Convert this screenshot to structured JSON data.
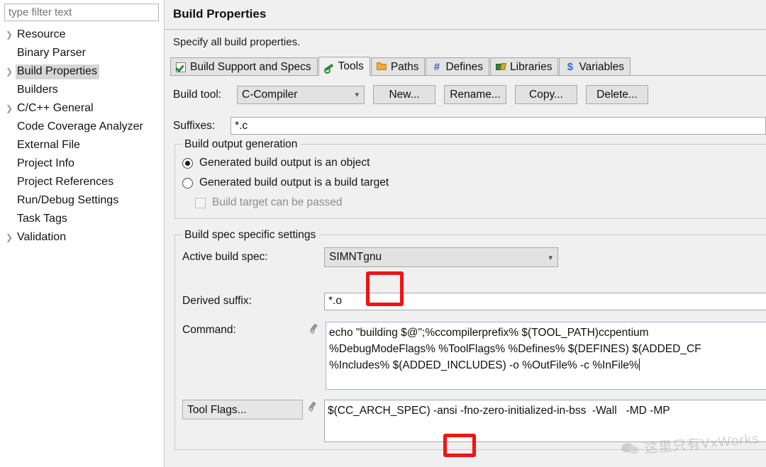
{
  "sidebar": {
    "filter_placeholder": "type filter text",
    "items": [
      {
        "label": "Resource",
        "expandable": true,
        "selected": false
      },
      {
        "label": "Binary Parser",
        "expandable": false,
        "selected": false
      },
      {
        "label": "Build Properties",
        "expandable": true,
        "selected": true
      },
      {
        "label": "Builders",
        "expandable": false,
        "selected": false
      },
      {
        "label": "C/C++ General",
        "expandable": true,
        "selected": false
      },
      {
        "label": "Code Coverage Analyzer",
        "expandable": false,
        "selected": false
      },
      {
        "label": "External File",
        "expandable": false,
        "selected": false
      },
      {
        "label": "Project Info",
        "expandable": false,
        "selected": false
      },
      {
        "label": "Project References",
        "expandable": false,
        "selected": false
      },
      {
        "label": "Run/Debug Settings",
        "expandable": false,
        "selected": false
      },
      {
        "label": "Task Tags",
        "expandable": false,
        "selected": false
      },
      {
        "label": "Validation",
        "expandable": true,
        "selected": false
      }
    ]
  },
  "page": {
    "title": "Build Properties",
    "description": "Specify all build properties."
  },
  "tabs": [
    {
      "label": "Build Support and Specs",
      "icon": "checkbox-checked-icon",
      "active": false
    },
    {
      "label": "Tools",
      "icon": "wrench-icon",
      "active": true
    },
    {
      "label": "Paths",
      "icon": "folder-icon",
      "active": false
    },
    {
      "label": "Defines",
      "icon": "hash-icon",
      "active": false
    },
    {
      "label": "Libraries",
      "icon": "books-icon",
      "active": false
    },
    {
      "label": "Variables",
      "icon": "dollar-icon",
      "active": false
    }
  ],
  "tools": {
    "build_tool_label": "Build tool:",
    "build_tool_value": "C-Compiler",
    "buttons": [
      {
        "label": "New..."
      },
      {
        "label": "Rename..."
      },
      {
        "label": "Copy..."
      },
      {
        "label": "Delete..."
      }
    ],
    "suffixes_label": "Suffixes:",
    "suffixes_value": "*.c",
    "output_group": {
      "title": "Build output generation",
      "radio_object": "Generated build output is an object",
      "radio_target": "Generated build output is a build target",
      "checkbox_passed": "Build target can be passed",
      "selected": "object",
      "checkbox_checked": false,
      "checkbox_enabled": false
    },
    "spec_group": {
      "title": "Build spec specific settings",
      "active_spec_label": "Active build spec:",
      "active_spec_value": "SIMNTgnu",
      "derived_suffix_label": "Derived suffix:",
      "derived_suffix_value": "*.o",
      "command_label": "Command:",
      "command_value": "echo \"building $@\";%ccompilerprefix% $(TOOL_PATH)ccpentium\n%DebugModeFlags% %ToolFlags% %Defines% $(DEFINES) $(ADDED_CF\n%Includes% $(ADDED_INCLUDES) -o %OutFile% -c %InFile%",
      "tool_flags_label": "Tool Flags...",
      "tool_flags_value": "$(CC_ARCH_SPEC) -ansi -fno-zero-initialized-in-bss  -Wall   -MD -MP"
    }
  },
  "annotations": {
    "highlight_color": "#f01414",
    "boxes": [
      {
        "name": "highlight-gnu",
        "target_text": "gnu"
      },
      {
        "name": "highlight-ansi",
        "target_text": "-ansi"
      }
    ]
  },
  "watermark": {
    "text": "这里只有VxWorks",
    "icon": "wechat-icon"
  }
}
